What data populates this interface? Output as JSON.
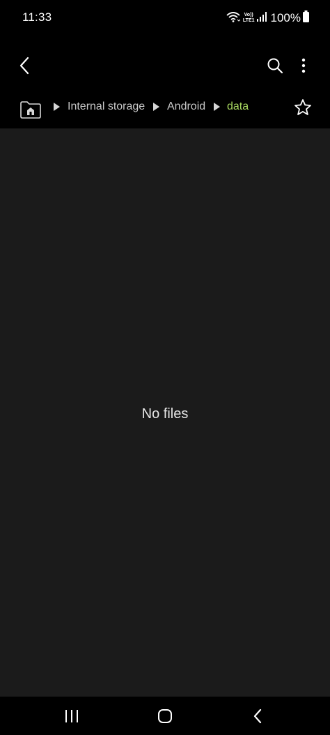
{
  "status_bar": {
    "time": "11:33",
    "volte_top": "Vo))",
    "volte_bottom": "LTE1",
    "battery_percent": "100%",
    "icons": [
      "wifi-icon",
      "signal-icon",
      "battery-icon"
    ]
  },
  "app_bar": {
    "back_icon": "chevron-left-icon",
    "search_icon": "search-icon",
    "more_icon": "more-vert-icon"
  },
  "breadcrumb": {
    "home_icon": "home-folder-icon",
    "items": [
      {
        "label": "Internal storage"
      },
      {
        "label": "Android"
      },
      {
        "label": "data"
      }
    ],
    "favorite_icon": "star-icon"
  },
  "content": {
    "empty_message": "No files"
  },
  "nav_bar": {
    "recents_icon": "recents-icon",
    "home_icon": "home-icon",
    "back_icon": "back-icon"
  },
  "colors": {
    "background": "#000000",
    "content_background": "#1b1b1b",
    "accent": "#a7d65f",
    "text": "#c8c8c8"
  }
}
